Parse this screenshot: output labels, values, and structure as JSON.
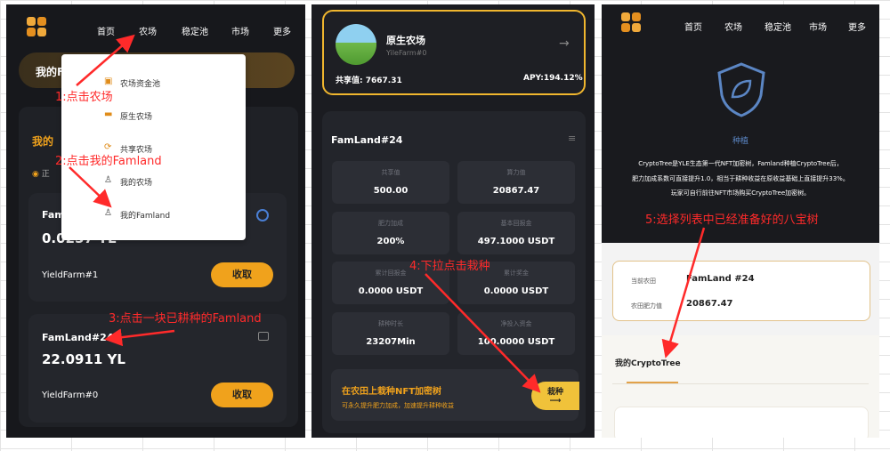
{
  "nav": {
    "home": "首页",
    "farm": "农场",
    "stable_pool": "稳定池",
    "market": "市场",
    "more": "更多"
  },
  "panel1": {
    "title_partial": "我的Far",
    "section_partial": "我的",
    "status_partial": "正",
    "menu": [
      "农场资金池",
      "原生农场",
      "共享农场",
      "我的农场",
      "我的Famland"
    ],
    "cards": [
      {
        "name": "FamLand#78",
        "amount": "0.0257 YL",
        "farm": "YieldFarm#1",
        "button": "收取"
      },
      {
        "name": "FamLand#24",
        "amount": "22.0911 YL",
        "farm": "YieldFarm#0",
        "button": "收取"
      }
    ]
  },
  "panel2": {
    "farm_name": "原生农场",
    "farm_sub": "YileFarm#0",
    "share_label": "共享值: 7667.31",
    "apy_label": "APY:194.12%",
    "land_title": "FamLand#24",
    "stats": [
      {
        "label": "共享值",
        "value": "500.00"
      },
      {
        "label": "算力值",
        "value": "20867.47"
      },
      {
        "label": "肥力加成",
        "value": "200%"
      },
      {
        "label": "基本回报金",
        "value": "497.1000 USDT"
      },
      {
        "label": "累计回报金",
        "value": "0.0000 USDT"
      },
      {
        "label": "累计奖金",
        "value": "0.0000 USDT"
      },
      {
        "label": "耕种时长",
        "value": "23207Min"
      },
      {
        "label": "净投入资金",
        "value": "100.0000 USDT"
      }
    ],
    "promo_title": "在农田上栽种NFT加密树",
    "promo_sub": "可永久提升肥力加成，加速提升耕种收益",
    "plant_button": "栽种"
  },
  "panel3": {
    "heading": "种植",
    "desc_line1": "CryptoTree是YLE生态第一代NFT加密树，Famland种植CryptoTree后，",
    "desc_line2": "肥力加成系数可直接提升1.0，相当于耕种收益在原收益基础上直接提升33%。",
    "desc_line3": "玩家可自行前往NFT市场购买CryptoTree加密树。",
    "current_land_label": "当前农田",
    "current_land_value": "FamLand #24",
    "fertility_label": "农田肥力值",
    "fertility_value": "20867.47",
    "my_tree_title": "我的CryptoTree"
  },
  "annotations": {
    "a1": "1:点击农场",
    "a2": "2:点击我的Famland",
    "a3": "3:点击一块已耕种的Famland",
    "a4": "4:下拉点击栽种",
    "a5": "5:选择列表中已经准备好的八宝树"
  },
  "colors": {
    "gold": "#f0a21c",
    "annotation": "#ff2a2a",
    "dark": "#17181c"
  }
}
